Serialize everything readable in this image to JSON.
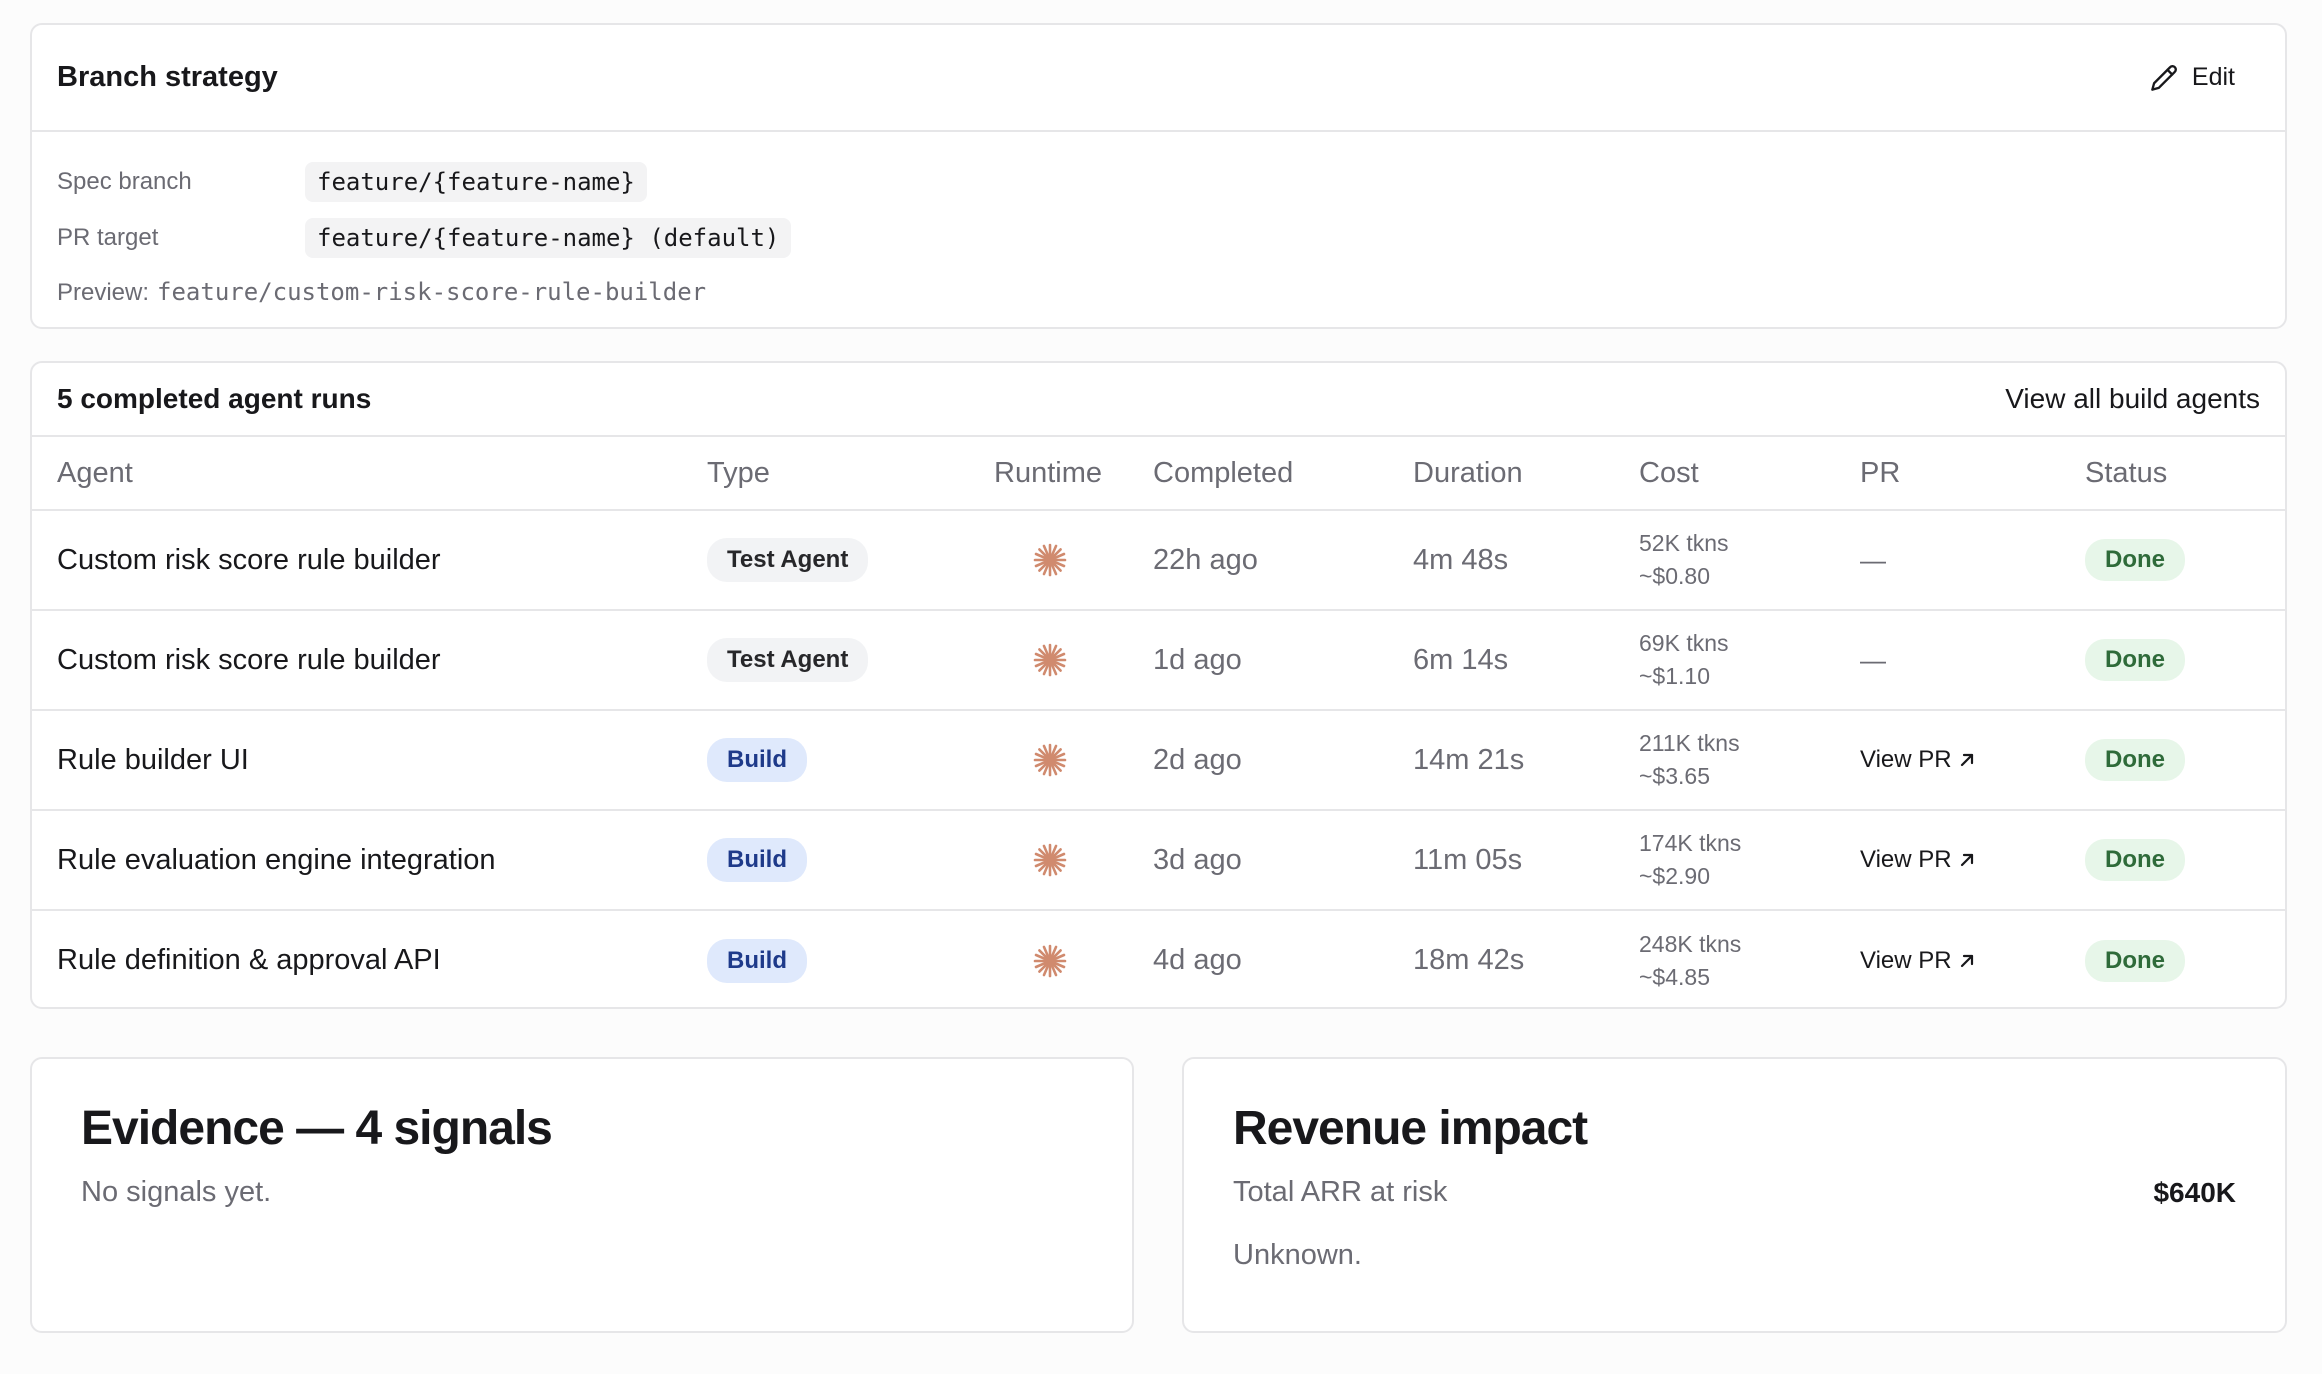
{
  "branch_strategy": {
    "title": "Branch strategy",
    "edit_label": "Edit",
    "spec_branch_label": "Spec branch",
    "spec_branch_value": "feature/{feature-name}",
    "pr_target_label": "PR target",
    "pr_target_value": "feature/{feature-name} (default)",
    "preview_label": "Preview:",
    "preview_value": "feature/custom-risk-score-rule-builder"
  },
  "runs": {
    "title": "5 completed agent runs",
    "view_all_label": "View all build agents",
    "columns": [
      "Agent",
      "Type",
      "Runtime",
      "Completed",
      "Duration",
      "Cost",
      "PR",
      "Status"
    ],
    "rows": [
      {
        "agent": "Custom risk score rule builder",
        "type": "Test Agent",
        "runtime_icon": "claude-asterisk-icon",
        "completed": "22h ago",
        "duration": "4m 48s",
        "tokens": "52K tkns",
        "cost": "~$0.80",
        "pr": "—",
        "status": "Done"
      },
      {
        "agent": "Custom risk score rule builder",
        "type": "Test Agent",
        "runtime_icon": "claude-asterisk-icon",
        "completed": "1d ago",
        "duration": "6m 14s",
        "tokens": "69K tkns",
        "cost": "~$1.10",
        "pr": "—",
        "status": "Done"
      },
      {
        "agent": "Rule builder UI",
        "type": "Build",
        "runtime_icon": "claude-asterisk-icon",
        "completed": "2d ago",
        "duration": "14m 21s",
        "tokens": "211K tkns",
        "cost": "~$3.65",
        "pr": "View PR",
        "status": "Done"
      },
      {
        "agent": "Rule evaluation engine integration",
        "type": "Build",
        "runtime_icon": "claude-asterisk-icon",
        "completed": "3d ago",
        "duration": "11m 05s",
        "tokens": "174K tkns",
        "cost": "~$2.90",
        "pr": "View PR",
        "status": "Done"
      },
      {
        "agent": "Rule definition & approval API",
        "type": "Build",
        "runtime_icon": "claude-asterisk-icon",
        "completed": "4d ago",
        "duration": "18m 42s",
        "tokens": "248K tkns",
        "cost": "~$4.85",
        "pr": "View PR",
        "status": "Done"
      }
    ]
  },
  "evidence": {
    "title": "Evidence — 4 signals",
    "empty_text": "No signals yet."
  },
  "revenue": {
    "title": "Revenue impact",
    "arr_label": "Total ARR at risk",
    "arr_value": "$640K",
    "note": "Unknown."
  },
  "colors": {
    "runtime_icon": "#d08a6e",
    "build_badge_bg": "#dfe9fc",
    "build_badge_text": "#1e3a8a",
    "done_badge_bg": "#e7f6e9",
    "done_badge_text": "#2f6b3a"
  }
}
